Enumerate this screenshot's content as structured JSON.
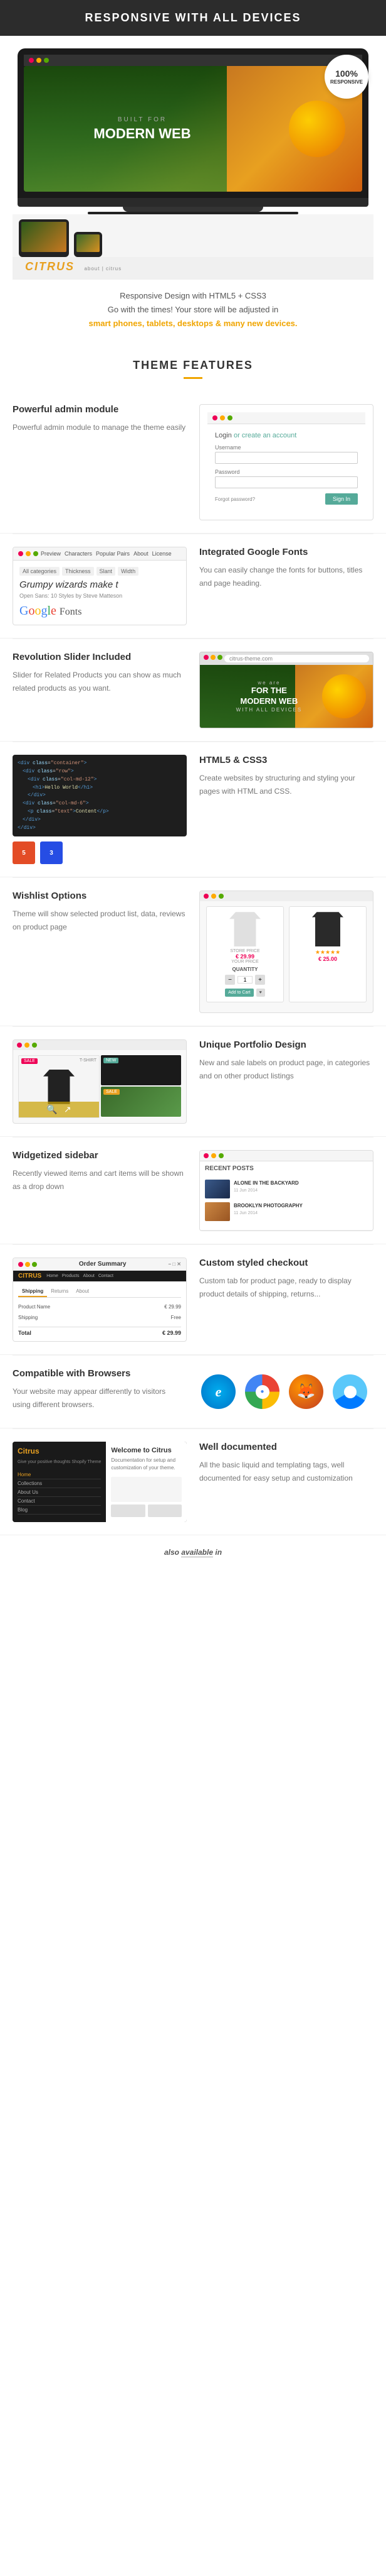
{
  "header": {
    "title": "RESPONSIVE WITH ALL DEVICES"
  },
  "hero": {
    "badge_percent": "100%",
    "badge_label": "RESPONSIVE",
    "desc_line1": "Responsive Design with HTML5 + CSS3",
    "desc_line2": "Go with the times! Your store will be adjusted in ",
    "desc_highlight": "smart phones, tablets, desktops & many new devices.",
    "built_text": "BUILT FOR",
    "modern_text": "MODERN WEB",
    "citrus_logo": "CITRUS"
  },
  "section_features": {
    "title": "THEME FEATURES"
  },
  "features": [
    {
      "id": "admin",
      "title": "Powerful admin module",
      "desc": "Powerful admin module to manage the theme easily",
      "side": "left",
      "login_label": "Login",
      "create_label": "or create an account",
      "username_label": "Username",
      "password_label": "Password",
      "forgot_label": "Forgot password?",
      "signin_label": "Sign In"
    },
    {
      "id": "fonts",
      "title": "Integrated Google Fonts",
      "desc": "You can easily change the fonts for buttons, titles and page heading.",
      "side": "right",
      "font_preview": "Grumpy wizards make t",
      "font_info": "Open Sans: 10 Styles by Steve Matteson",
      "google_text": "Google Fonts"
    },
    {
      "id": "slider",
      "title": "Revolution Slider Included",
      "desc": "Slider for Related Products you can show as much related products as you want.",
      "side": "left",
      "we_are": "we are",
      "for_text": "FOR THE MODERN WEB",
      "with_text": "WITH ALL DEVICES"
    },
    {
      "id": "html5",
      "title": "HTML5 & CSS3",
      "desc": "Create websites by structuring and styling your pages with HTML and CSS.",
      "side": "right"
    },
    {
      "id": "wishlist",
      "title": "Wishlist Options",
      "desc": "Theme will show selected product list, data, reviews on product page",
      "side": "left",
      "price1": "€ 29.99",
      "price2": "€ 25.00",
      "label_store": "STORE PRICE",
      "label_yours": "YOUR PRICE",
      "qty_label": "QUANTITY"
    },
    {
      "id": "portfolio",
      "title": "Unique Portfolio Design",
      "desc": "New and sale labels on product page, in categories and on other product listings",
      "side": "right",
      "tshirt_label": "T-SHIRT",
      "sale_label": "SALE",
      "new_label": "NEW"
    },
    {
      "id": "sidebar",
      "title": "Widgetized sidebar",
      "desc": "Recently viewed items and cart items will be shown as a drop down",
      "side": "left",
      "recent_posts_title": "RECENT POSTS",
      "post1_title": "ALONE IN THE BACKYARD",
      "post1_date": "11 Jun 2014",
      "post2_title": "BROOKLYN PHOTOGRAPHY",
      "post2_date": "11 Jun 2014"
    },
    {
      "id": "checkout",
      "title": "Custom styled checkout",
      "desc": "Custom tab for product page, ready to display product details of shipping, returns...",
      "side": "right",
      "checkout_title": "Order Summary",
      "tabs": [
        "Shipping",
        "Returns",
        "About"
      ],
      "logo": "CITRUS"
    },
    {
      "id": "browsers",
      "title": "Compatible with Browsers",
      "desc": "Your website may appear differently to visitors using different browsers.",
      "side": "left"
    },
    {
      "id": "docs",
      "title": "Well documented",
      "desc": "All the basic liquid and templating tags, well documented for easy setup and customization",
      "side": "right",
      "doc_logo": "Citrus",
      "doc_tagline": "Give your positive thoughts Shopify Theme",
      "nav_items": [
        "Home",
        "Collections",
        "About Us",
        "Contact",
        "Blog"
      ]
    }
  ],
  "also_available": {
    "prefix": "also",
    "highlight": "available",
    "suffix": "in"
  },
  "colors": {
    "accent": "#e8a020",
    "dark": "#2c2c2c",
    "green": "#5a9"
  }
}
